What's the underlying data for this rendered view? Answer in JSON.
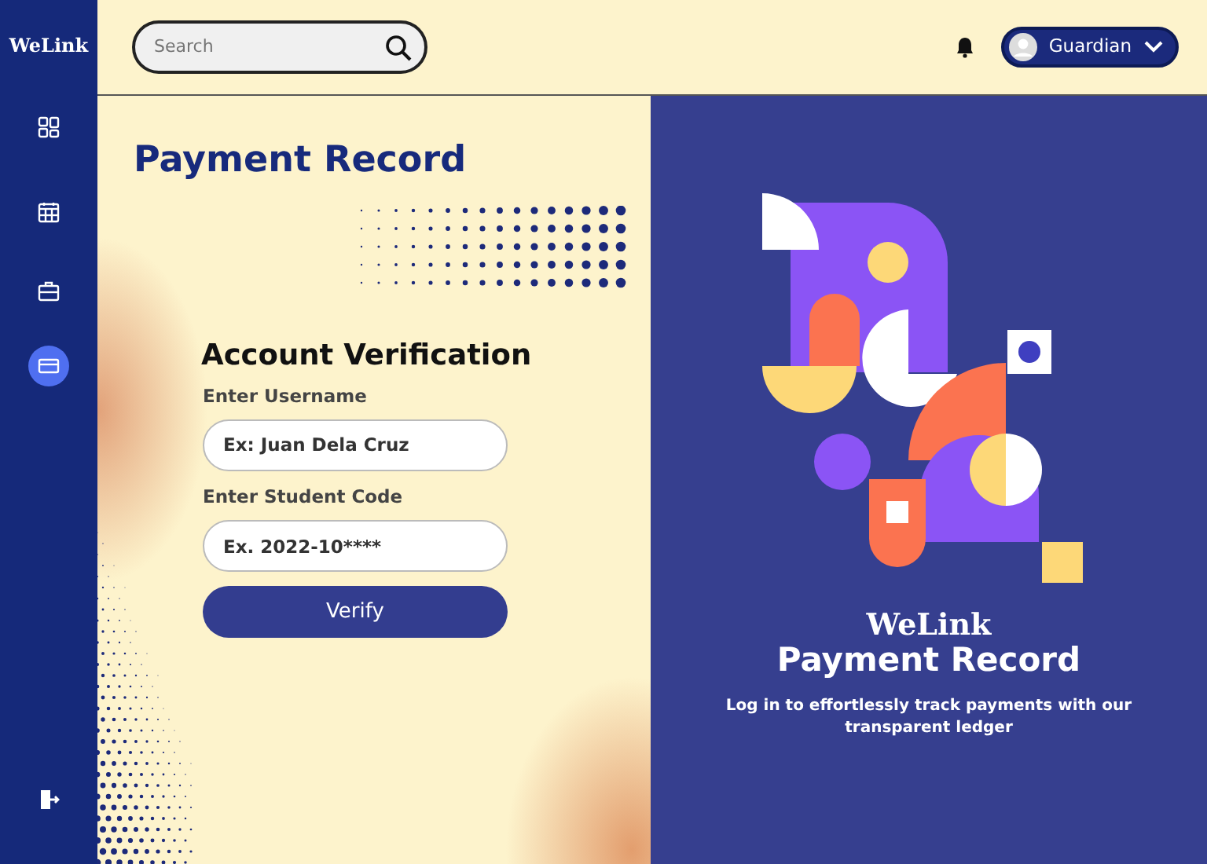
{
  "sidebar": {
    "logo": "WeLink",
    "items": [
      {
        "selected": false
      },
      {
        "selected": false
      },
      {
        "selected": false
      },
      {
        "selected": true
      }
    ]
  },
  "topbar": {
    "search": {
      "placeholder": "Search"
    },
    "user": {
      "name": "Guardian"
    }
  },
  "page_title": "Payment Record",
  "form": {
    "heading": "Account Verification",
    "fields": [
      {
        "label": "Enter Username",
        "placeholder": "Ex: Juan Dela Cruz"
      },
      {
        "label": "Enter Student Code",
        "placeholder": "Ex. 2022-10****"
      }
    ],
    "button": "Verify"
  },
  "promo": {
    "brand": "WeLink",
    "title": "Payment Record",
    "description": "Log in to effortlessly track payments with our transparent ledger"
  }
}
